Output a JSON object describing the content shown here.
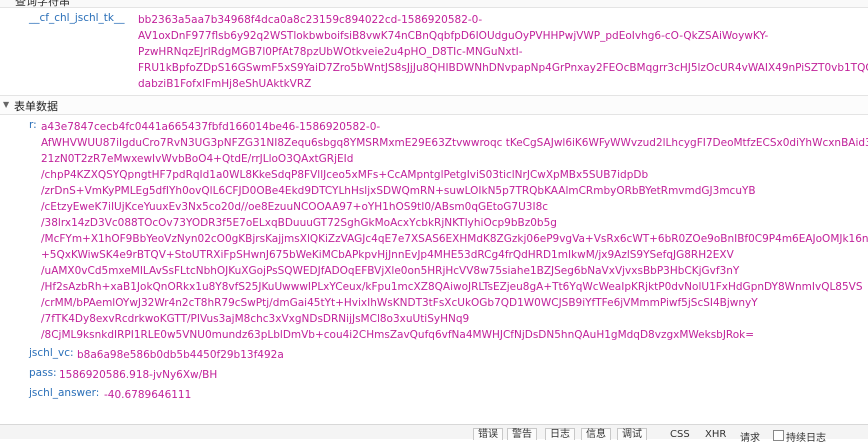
{
  "header_partial": {
    "label": "查询字符串"
  },
  "query_params": [
    {
      "key": "__cf_chl_jschl_tk__",
      "value_lines": [
        "bb2363a5aa7b34968f4dca0a8c23159c894022cd-1586920582-0-",
        "AV1oxDnF977flsb6y92q2WSTlokbwboifsiB8vwK74nCBnQqbfpD6IOUdguOyPVHHPwjVWP_pdEoIvhg6-cO-QkZSAiWoywKY-",
        "PzwHRNqzEJrlRdgMGB7l0PfAt78pzUbWOtkveie2u4pHO_D8TIc-MNGuNxtI-",
        "FRU1kBpfoZDpS16GSwmF5xS9YaiD7Zro5bWntJS8sJjJu8QHIBDWNhDNvpapNp4GrPnxay2FEOcBMqgrr3cHJ5lzOcUR4vWAIX49nPiSZT0vb1TQG",
        "dabziB1FofxlFmHj8eShUAktkVRZ"
      ]
    }
  ],
  "form_section": {
    "title": "表单数据"
  },
  "form_fields": {
    "r": {
      "key": "r:",
      "value_lines": [
        "a43e7847cecb4fc0441a665437fbfd166014be46-1586920582-0-",
        "AfWHVWUU87iIgduCro7RvN3UG3pNFZG31NI8Zequ6sbgq8YMSRMxmE29E63Ztvwwroqc tKeCgSAJwl6iK6WFyWWvzud2lLhcygFI7DeoMtfzECSx0diYhWcxnBAid3mIu7",
        "21zN0T2zR7eMwxewIvWvbBoO4+QtdE/rrJLloO3QAxtGRjEId",
        "/chpP4KZXQSYQpngtHF7pdRqId1a0WL8KkeSdqP8FVllJceo5xMFs+CcAMpntglPetgIviS03ticlNrJCwXpMBx5SUB7idpDb",
        "/zrDnS+VmKyPMLEg5dfIYh0ovQlL6CFJD0OBe4Ekd9DTCYLhHsljxSDWQmRN+suwLOIkN5p7TRQbKAAlmCRmbyORbBYetRmvmdGJ3mcuYB",
        "/cEtzyEweK7iIUjKceYuuxEv3Nx5co20d//oe8EzuuNCOOAA97+oYH1hOS9tI0/ABsm0qGEtoG7U3I8c",
        "/38lrx14zD3Vc088TOcOv73YODR3f5E7oELxqBDuuuGT72SghGkMoAcxYcbkRjNKTIyhiOcp9bBz0b5g",
        "/McFYm+X1hOF9BbYeoVzNyn02cO0gKBjrsKajjmsXlQKiZzVAGJc4qE7e7XSAS6EXHMdK8ZGzkj06eP9vgVa+VsRx6cWT+6bR0ZOe9oBnIBf0C9P4m6EAJoOMJk16nxjGWvs",
        "+5QxKWiwSK4e9rBTQV+StoUTRXiFpSHwnJ675bWeKiMCbAPkpvHjJnnEvJp4MHE53dRCg4frQdHRD1mIkwM/jx9AzlS9YSefqJG8RH2EXV",
        "/uAMX0vCd5mxeMILAvSsFLtcNbhOJKuXGojPsSQWEDJfADOqEFBVjXle0on5HRjHcVV8w75siahe1BZJSeg6bNaVxVjvxsBbP3HbCKjGvf3nY",
        "/Hf2sAzbRh+xaB1JokQnORkx1u8Y8vfS25JKuUwwwIPLxYCeux/kFpu1mcXZ8QAiwoJRLTsEZjeu8gA+Tt6YqWcWeaIpKRjktP0dvNolU1FxHdGpnDY8WnmIvQL85VS",
        "/crMM/bPAemlOYwJ32Wr4n2cT8hR79cSwPtj/dmGai45tYt+HvixIhWsKNDT3tFsXcUkOGb7QD1W0WCJSB9iYfTFe6jVMmmPiwf5jScSI4BjwnyY",
        "/7fTK4Dy8exvRcdrkwoKGTT/PIVus3ajM8chc3xVxgNDsDRNijJsMCl8o3xuUtiSyHNq9",
        "/8CjML9ksnkdIRPI1RLE0w5VNU0mundz63pLblDmVb+cou4i2CHmsZavQufq6vfNa4MWHJCfNjDsDN5hnQAuH1gMdqD8vzgxMWeksbJRok="
      ]
    },
    "jschl_vc": {
      "key": "jschl_vc:",
      "value": "b8a6a98e586b0db5b4450f29b13f492a"
    },
    "pass": {
      "key": "pass:",
      "value": "1586920586.918-jvNy6Xw/BH"
    },
    "jschl_answer": {
      "key": "jschl_answer:",
      "value": "-40.6789646111"
    }
  },
  "toolbar": {
    "buttons": [
      "错误",
      "警告",
      "日志",
      "信息",
      "调试"
    ],
    "filters": [
      "CSS",
      "XHR",
      "请求"
    ],
    "persist_label": "持续日志"
  }
}
